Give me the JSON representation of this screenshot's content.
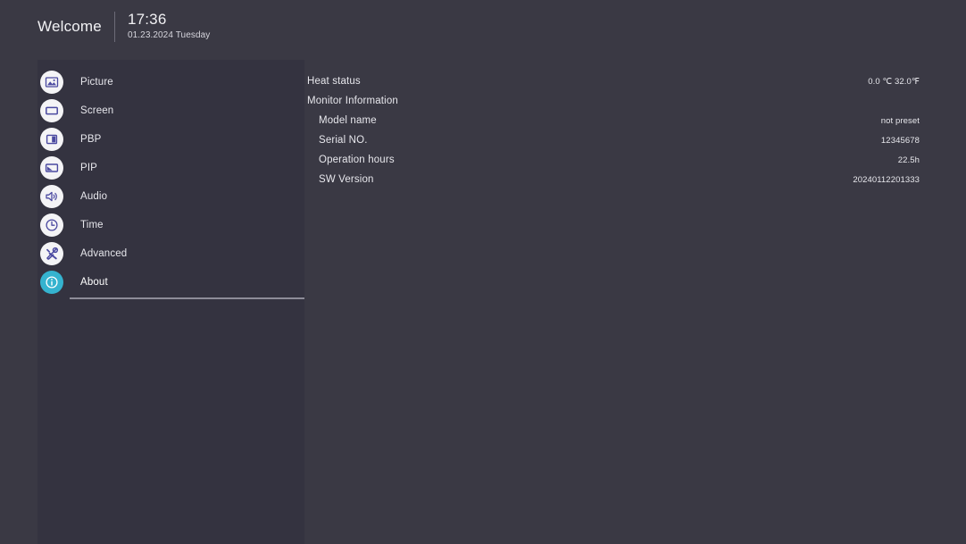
{
  "header": {
    "welcome": "Welcome",
    "time": "17:36",
    "date": "01.23.2024 Tuesday"
  },
  "sidebar": {
    "items": [
      {
        "label": "Picture",
        "icon": "picture-icon",
        "active": false
      },
      {
        "label": "Screen",
        "icon": "screen-icon",
        "active": false
      },
      {
        "label": "PBP",
        "icon": "pbp-icon",
        "active": false
      },
      {
        "label": "PIP",
        "icon": "pip-icon",
        "active": false
      },
      {
        "label": "Audio",
        "icon": "audio-icon",
        "active": false
      },
      {
        "label": "Time",
        "icon": "clock-icon",
        "active": false
      },
      {
        "label": "Advanced",
        "icon": "tools-icon",
        "active": false
      },
      {
        "label": "About",
        "icon": "info-icon",
        "active": true
      }
    ]
  },
  "content": {
    "rows": [
      {
        "label": "Heat status",
        "value": "0.0 ℃ 32.0℉",
        "level": 0
      },
      {
        "label": "Monitor Information",
        "value": "",
        "level": 0
      },
      {
        "label": "Model name",
        "value": "not preset",
        "level": 1
      },
      {
        "label": "Serial NO.",
        "value": "12345678",
        "level": 1
      },
      {
        "label": "Operation hours",
        "value": "22.5h",
        "level": 1
      },
      {
        "label": "SW Version",
        "value": "20240112201333",
        "level": 1
      }
    ]
  },
  "colors": {
    "background": "#3a3944",
    "sidebar_panel": "#343340",
    "icon_bubble": "#f4f4f6",
    "icon_glyph": "#4a49a0",
    "active_accent": "#35b3cf",
    "text_primary": "#e7e7ec",
    "underline": "#8d8c98"
  }
}
